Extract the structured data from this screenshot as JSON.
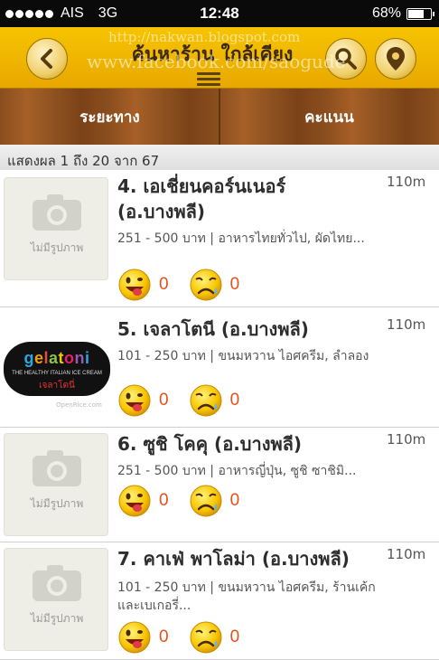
{
  "status": {
    "carrier": "AIS",
    "network": "3G",
    "time": "12:48",
    "battery": "68%"
  },
  "header": {
    "title": "ค้นหาร้าน ใกล้เคียง"
  },
  "tabs": [
    {
      "label": "ระยะทาง"
    },
    {
      "label": "คะแนน"
    }
  ],
  "results_text": "แสดงผล 1 ถึง 20 จาก 67",
  "watermarks": [
    "http://nakwan.blogspot.com",
    "www.facebook.com/saogude"
  ],
  "no_image_label": "ไม่มีรูปภาพ",
  "icons": {
    "back": "back-arrow-icon",
    "search": "search-icon",
    "location": "location-pin-icon",
    "menu": "menu-icon",
    "camera": "camera-icon",
    "like": "smiley-face-icon",
    "dislike": "sad-face-icon"
  },
  "colors": {
    "header": "#f7c400",
    "count": "#e8501a",
    "tabs": "#8a4e1e"
  },
  "items": [
    {
      "name": "4. เอเชี่ยนคอร์นเนอร์ (อ.บางพลี)",
      "distance": "110m",
      "desc": "251 - 500 บาท | อาหารไทยทั่วไป, ผัดไทย...",
      "likes": "0",
      "dislikes": "0"
    },
    {
      "name": "5. เจลาโตนี (อ.บางพลี)",
      "distance": "110m",
      "desc": "101 - 250 บาท | ขนมหวาน ไอศครีม, ลำลอง",
      "likes": "0",
      "dislikes": "0",
      "logo": {
        "word": "gelatoni",
        "tagline": "THE HEALTHY ITALIAN ICE CREAM",
        "thai": "เจลาโตนี่",
        "credit": "OpenRice.com"
      }
    },
    {
      "name": "6. ซูชิ โคคุ (อ.บางพลี)",
      "distance": "110m",
      "desc": "251 - 500 บาท | อาหารญี่ปุ่น, ซูชิ ซาชิมิ...",
      "likes": "0",
      "dislikes": "0"
    },
    {
      "name": "7. คาเฟ่ พาโลม่า (อ.บางพลี)",
      "distance": "110m",
      "desc": "101 - 250 บาท | ขนมหวาน ไอศครีม, ร้านเค้กและเบเกอรี่...",
      "likes": "0",
      "dislikes": "0"
    }
  ]
}
